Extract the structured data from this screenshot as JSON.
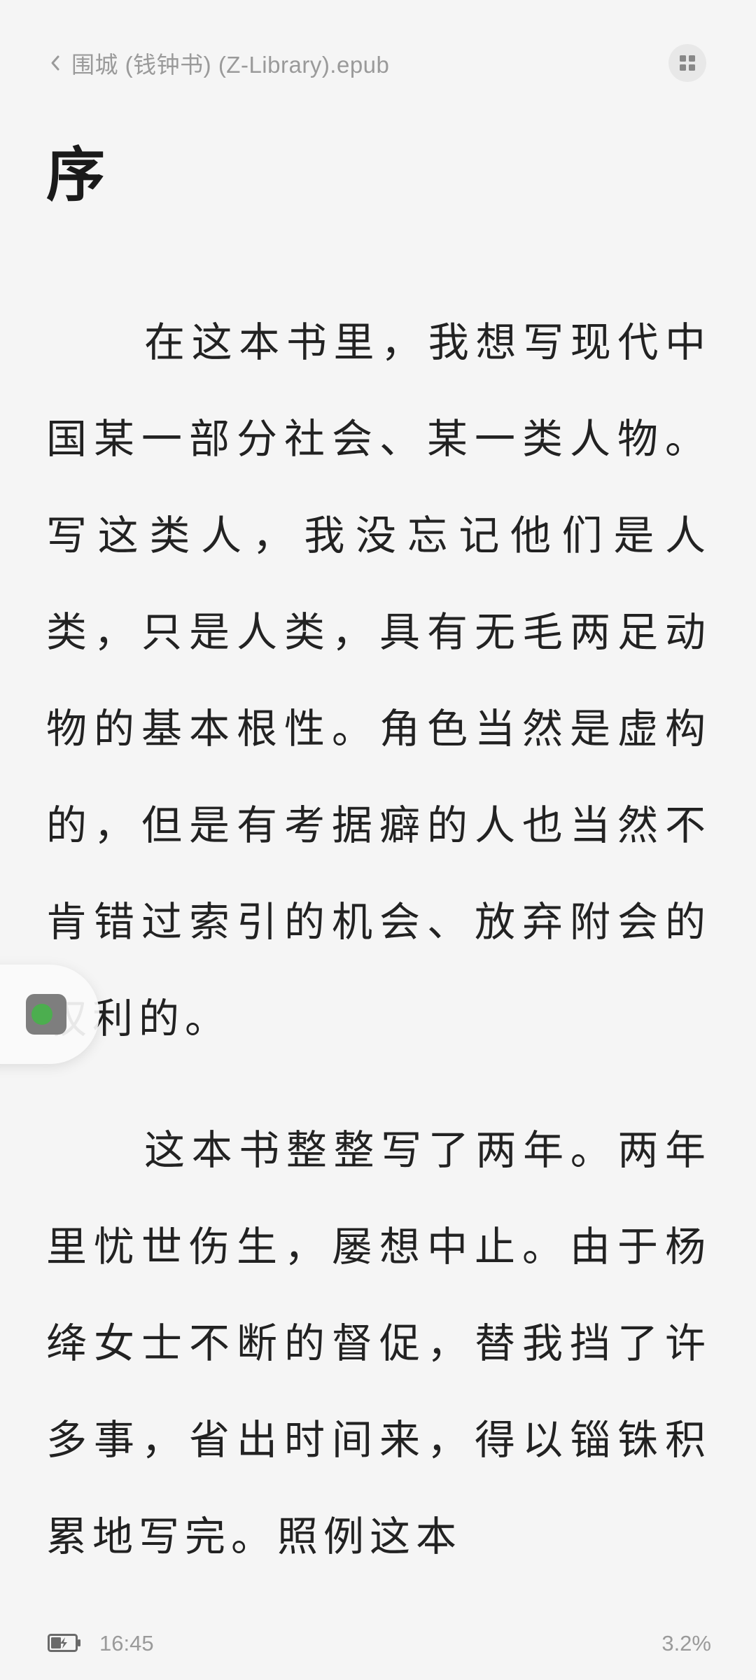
{
  "header": {
    "book_title": "围城 (钱钟书) (Z-Library).epub",
    "back_icon": "chevron-left-icon",
    "menu_icon": "grid-icon"
  },
  "chapter": {
    "title": "序"
  },
  "content": {
    "paragraphs": [
      "在这本书里，我想写现代中国某一部分社会、某一类人物。写这类人，我没忘记他们是人类，只是人类，具有无毛两足动物的基本根性。角色当然是虚构的，但是有考据癖的人也当然不肯错过索引的机会、放弃附会的权利的。",
      "这本书整整写了两年。两年里忧世伤生，屡想中止。由于杨绛女士不断的督促，替我挡了许多事，省出时间来，得以锱铢积累地写完。照例这本"
    ]
  },
  "status": {
    "battery_icon": "battery-charging-icon",
    "time": "16:45",
    "progress": "3.2%"
  },
  "floating": {
    "icon": "app-shortcut-icon"
  },
  "colors": {
    "background": "#f5f5f5",
    "text": "#222222",
    "muted": "#9a9a9a",
    "accent": "#4cae4f"
  }
}
